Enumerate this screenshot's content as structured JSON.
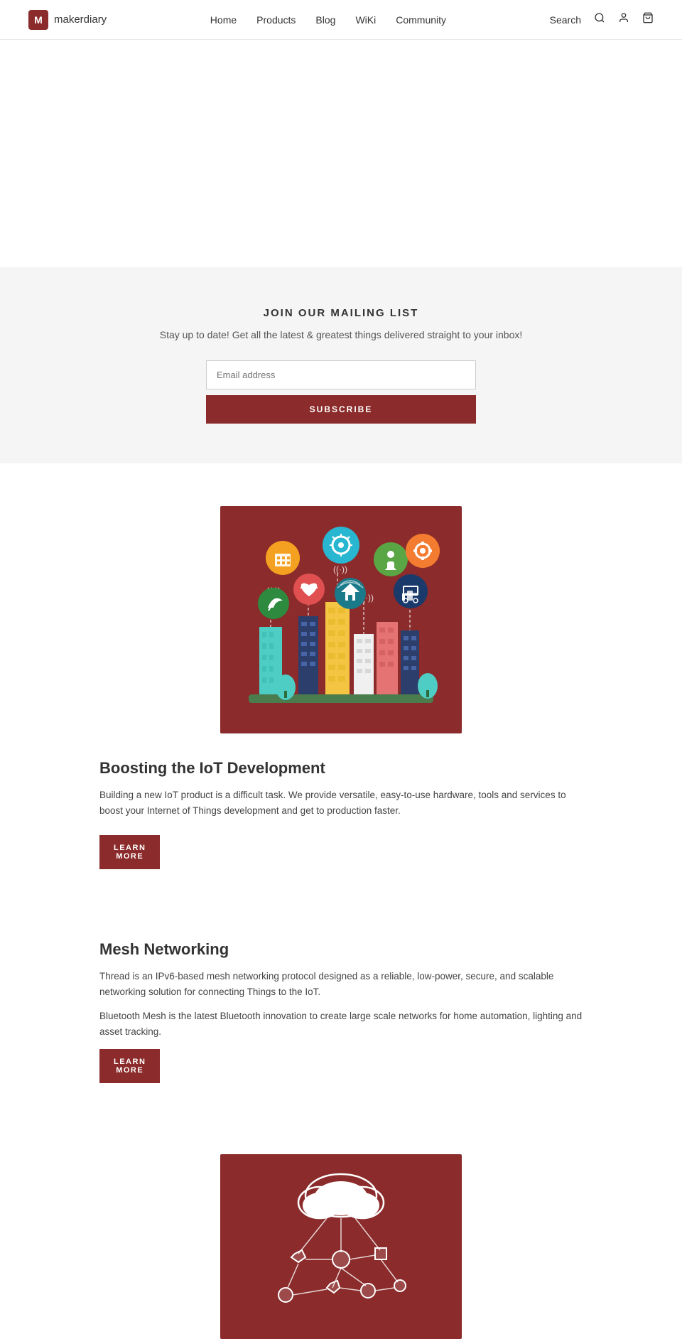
{
  "header": {
    "logo_letter": "M",
    "logo_name": "makerdiary",
    "nav_items": [
      {
        "label": "Home",
        "href": "#"
      },
      {
        "label": "Products",
        "href": "#"
      },
      {
        "label": "Blog",
        "href": "#"
      },
      {
        "label": "WiKi",
        "href": "#"
      },
      {
        "label": "Community",
        "href": "#"
      }
    ],
    "search_label": "Search",
    "search_icon": "🔍",
    "user_icon": "👤",
    "cart_icon": "🛒"
  },
  "mailing": {
    "title": "JOIN OUR MAILING LIST",
    "subtitle": "Stay up to date! Get all the latest & greatest things delivered straight to your inbox!",
    "email_placeholder": "Email address",
    "subscribe_label": "SUBSCRIBE"
  },
  "iot_section": {
    "title": "Boosting the IoT Development",
    "description": "Building a new IoT product is a difficult task. We provide versatile, easy-to-use hardware, tools and services to boost your Internet of Things development and get to production faster.",
    "learn_more": "LEARN\nMORE"
  },
  "mesh_section": {
    "title": "Mesh Networking",
    "desc1": "Thread is an IPv6-based mesh networking protocol designed as a reliable, low-power, secure, and scalable networking solution for connecting Things to the IoT.",
    "desc2": "Bluetooth Mesh is the latest Bluetooth innovation to create large scale networks for home automation, lighting and asset tracking.",
    "learn_more": "LEARN\nMORE"
  },
  "colors": {
    "brand": "#8b2b2b",
    "text": "#333",
    "muted": "#555"
  }
}
